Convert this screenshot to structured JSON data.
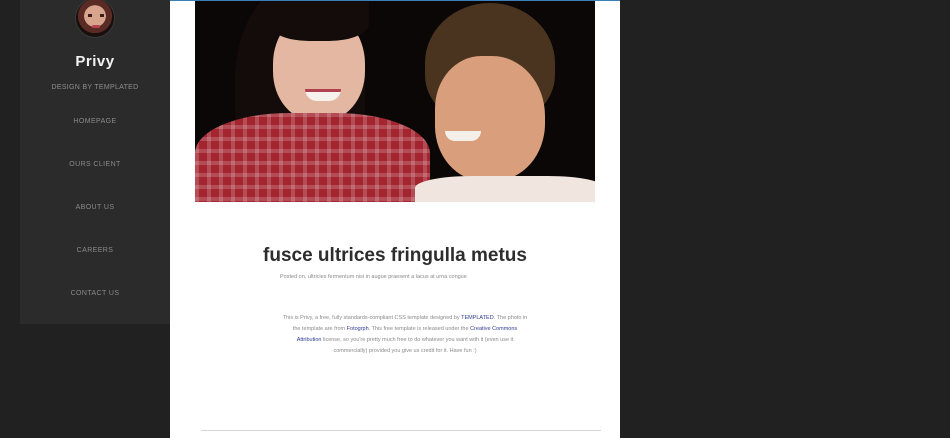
{
  "sidebar": {
    "site_title": "Privy",
    "tagline": "DESIGN BY TEMPLATED",
    "nav": [
      "HOMEPAGE",
      "OURS CLIENT",
      "ABOUT US",
      "CAREERS",
      "CONTACT US"
    ]
  },
  "post": {
    "title": "fusce ultrices fringulla metus",
    "subtitle": "Posted on, ultricies fermentum nisi in augue praesent a lacus at urna congue",
    "body": {
      "p1": "This is ",
      "name": "Privy",
      "p2": ", a free, fully standards-compliant CSS template designed by ",
      "link1": "TEMPLATED",
      "p3": ". The photo in the template are from ",
      "link2": "Fotogrph",
      "p4": ". This free template is released under the ",
      "link3": "Creative Commons Attribution",
      "p5": " license, so you're pretty much free to do whatever you want with it (even use it commercially) provided you give us credit for it. Have fun :)"
    }
  },
  "colors": {
    "page_background": "#212121",
    "sidebar_background": "#2b2b2b",
    "content_background": "#ffffff",
    "link": "#2f3c8e"
  }
}
